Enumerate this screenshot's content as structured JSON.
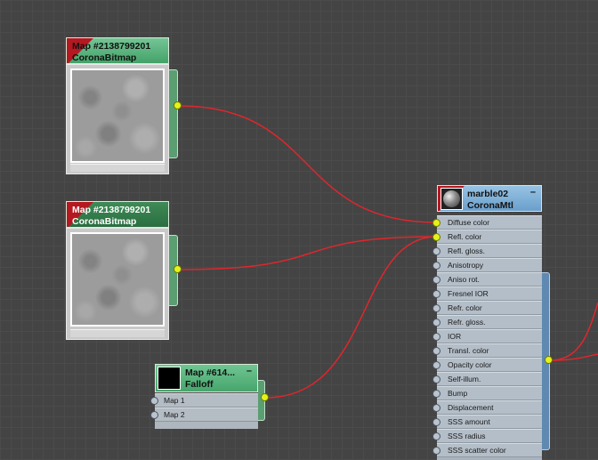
{
  "nodes": {
    "bitmap1": {
      "name": "Map #2138799201",
      "type": "CoronaBitmap"
    },
    "bitmap2": {
      "name": "Map #2138799201",
      "type": "CoronaBitmap"
    },
    "falloff": {
      "name": "Map #614...",
      "type": "Falloff",
      "slots": [
        "Map 1",
        "Map 2"
      ]
    },
    "material": {
      "name": "marble02",
      "type": "CoronaMtl",
      "slots": [
        "Diffuse color",
        "Refl. color",
        "Refl. gloss.",
        "Anisotropy",
        "Aniso rot.",
        "Fresnel IOR",
        "Refr. color",
        "Refr. gloss.",
        "IOR",
        "Transl. color",
        "Opacity color",
        "Self-illum.",
        "Bump",
        "Displacement",
        "SSS amount",
        "SSS radius",
        "SSS scatter color"
      ]
    }
  },
  "colors": {
    "wire": "#e0262c",
    "socket_active": "#e4f21a",
    "bitmap_header": "#4fae73",
    "material_header": "#7fb3db",
    "map_corner": "#b51821"
  }
}
